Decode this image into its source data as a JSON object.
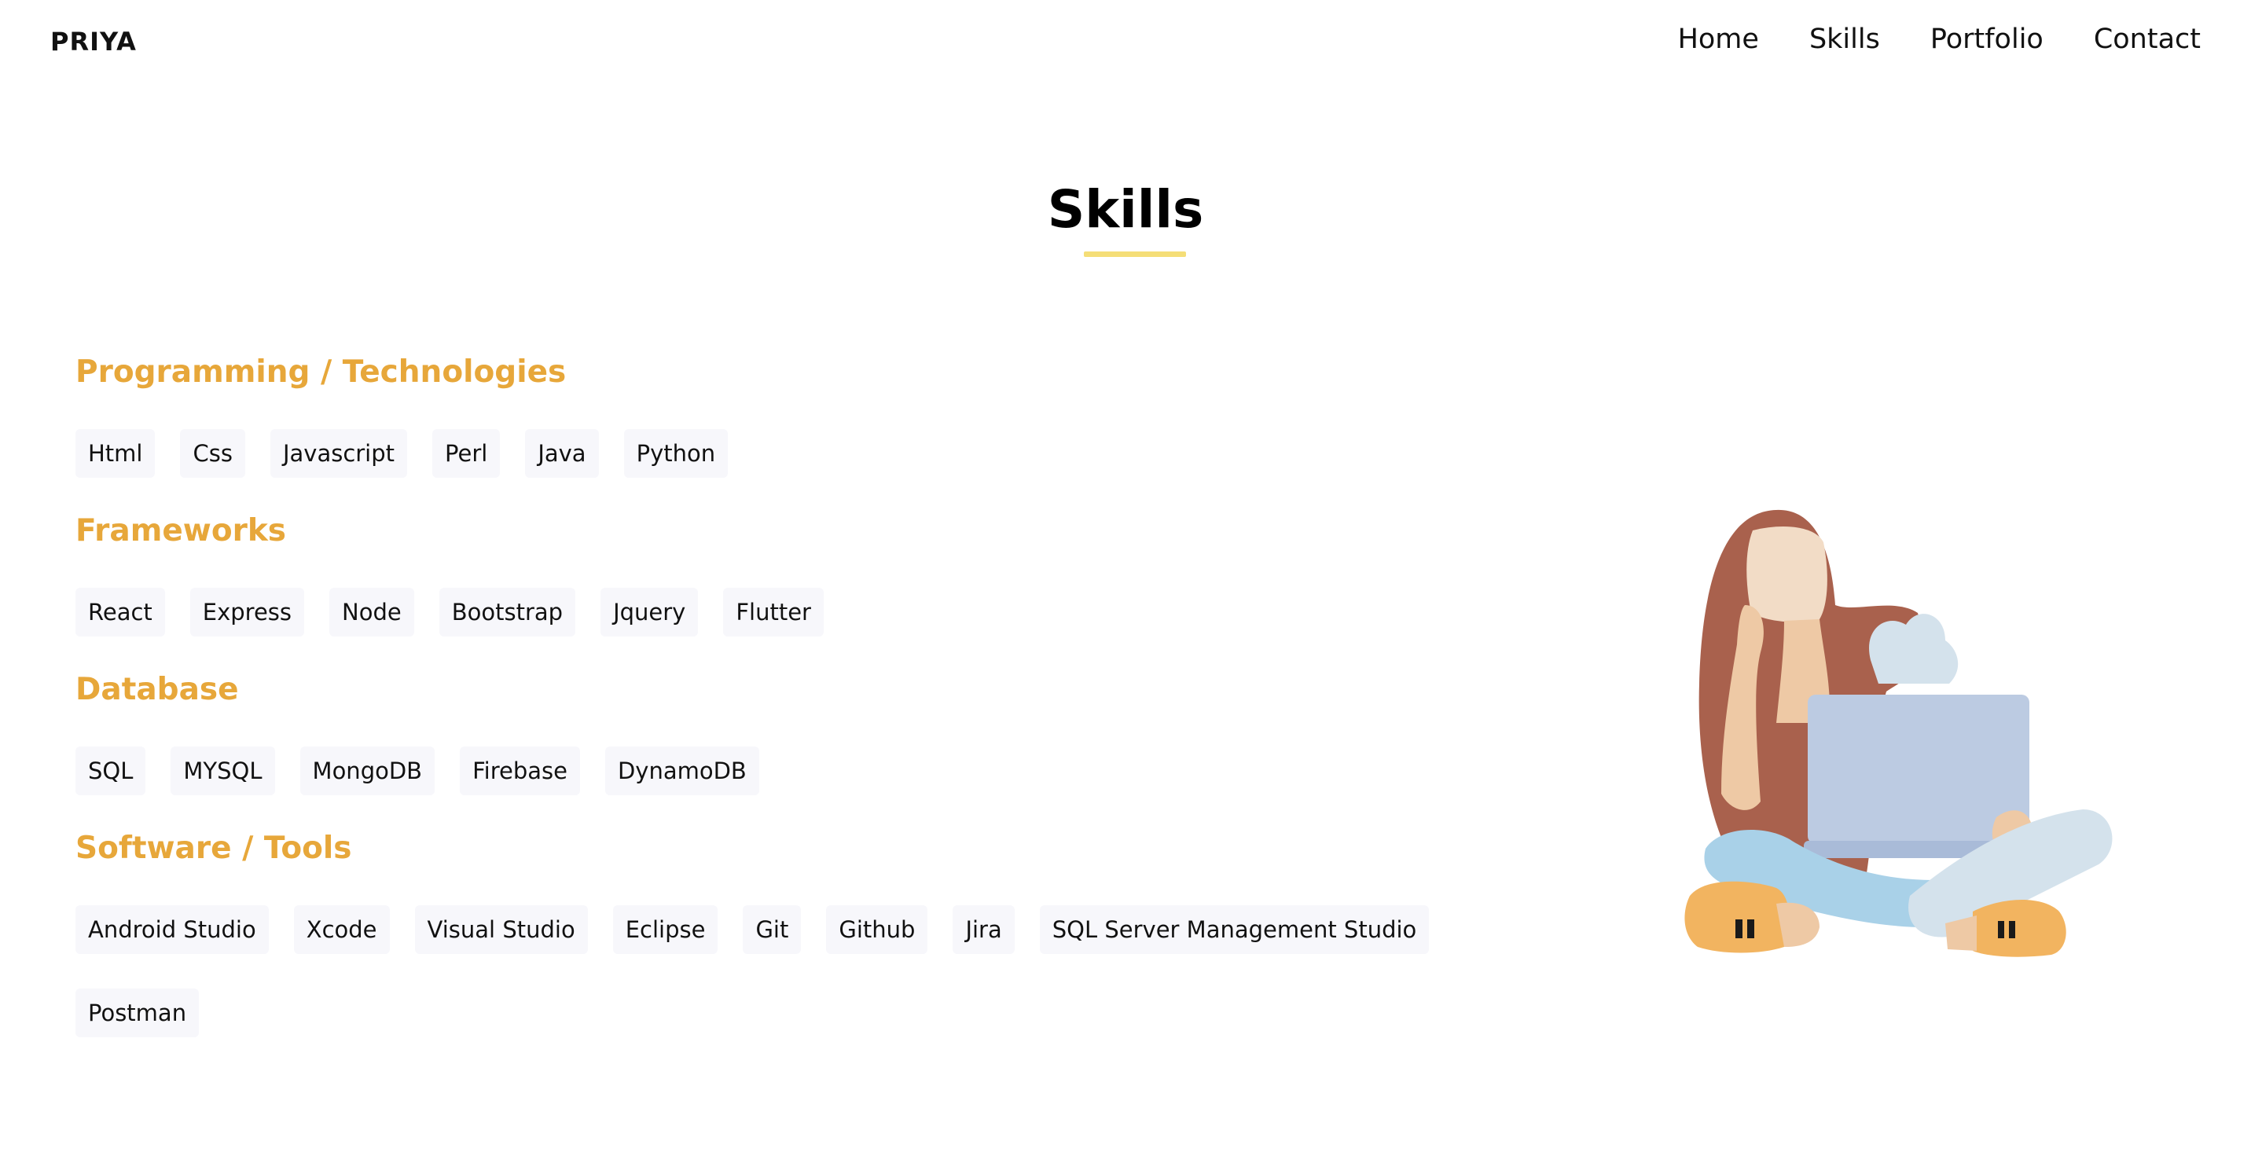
{
  "brand": "PRIYA",
  "nav": [
    "Home",
    "Skills",
    "Portfolio",
    "Contact"
  ],
  "section_title": "Skills",
  "categories": [
    {
      "title": "Programming / Technologies",
      "items": [
        "Html",
        "Css",
        "Javascript",
        "Perl",
        "Java",
        "Python"
      ]
    },
    {
      "title": "Frameworks",
      "items": [
        "React",
        "Express",
        "Node",
        "Bootstrap",
        "Jquery",
        "Flutter"
      ]
    },
    {
      "title": "Database",
      "items": [
        "SQL",
        "MYSQL",
        "MongoDB",
        "Firebase",
        "DynamoDB"
      ]
    },
    {
      "title": "Software / Tools",
      "items": [
        "Android Studio",
        "Xcode",
        "Visual Studio",
        "Eclipse",
        "Git",
        "Github",
        "Jira",
        "SQL Server Management Studio",
        "Postman"
      ]
    }
  ],
  "illustration": "woman-with-laptop-illustration",
  "colors": {
    "accent": "#e7a73a",
    "underline": "#f5de77",
    "chip_bg": "#f7f7fb"
  }
}
